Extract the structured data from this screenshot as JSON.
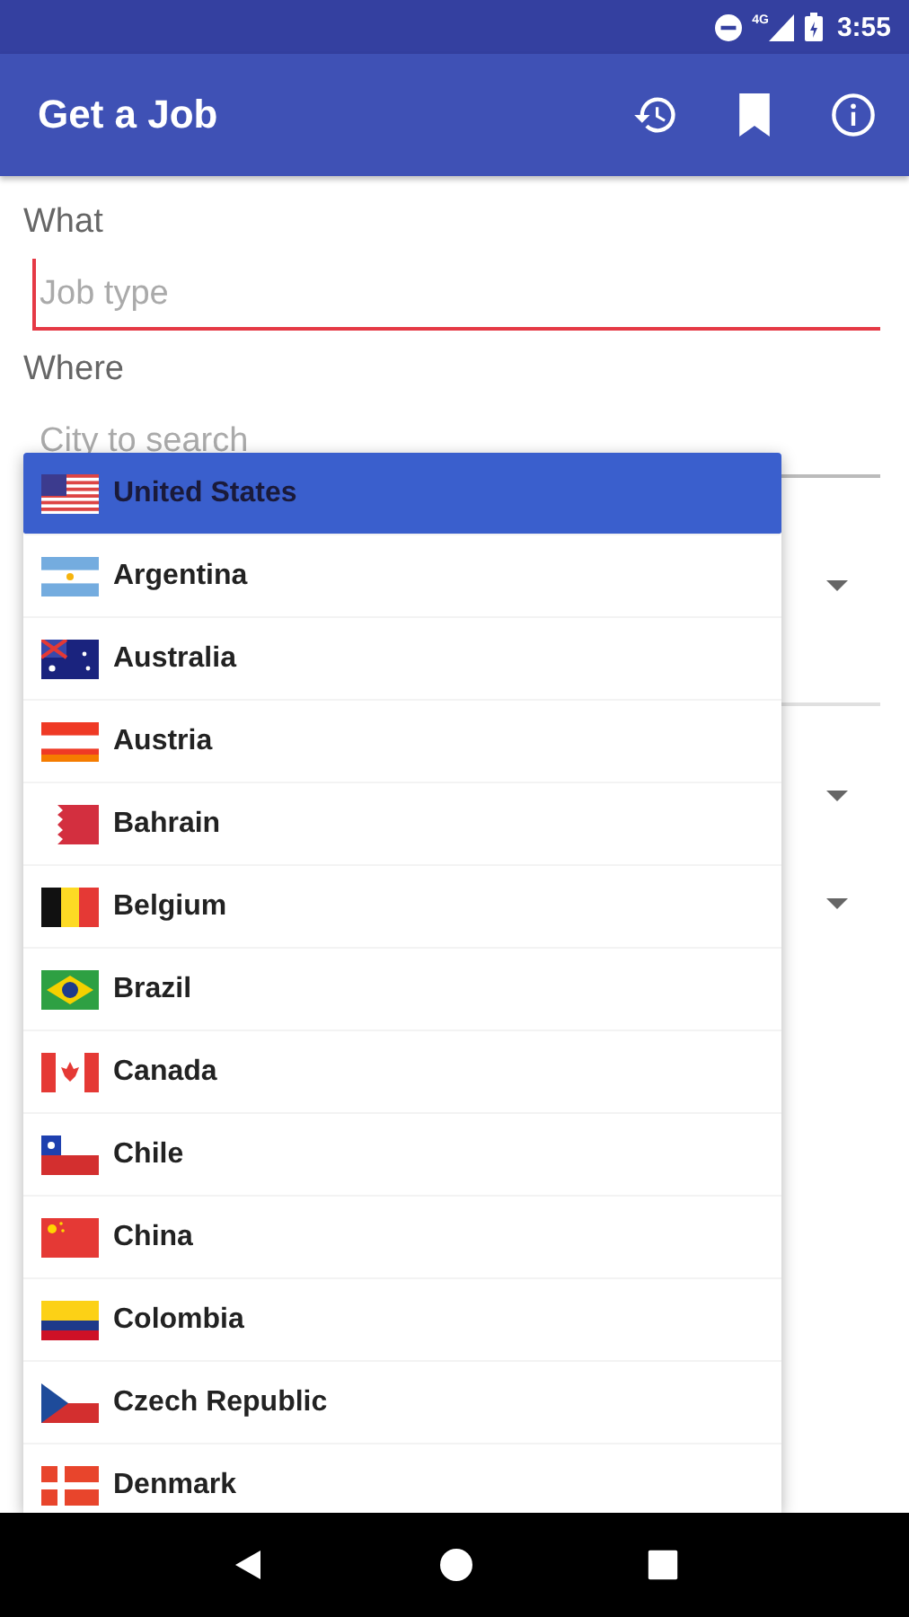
{
  "status_bar": {
    "time": "3:55",
    "network": "4G"
  },
  "app_bar": {
    "title": "Get a Job"
  },
  "form": {
    "what": {
      "label": "What",
      "placeholder": "Job type",
      "focused": true
    },
    "where": {
      "label": "Where",
      "placeholder": "City to search",
      "focused": false
    }
  },
  "country_menu": {
    "items": [
      {
        "label": "United States",
        "selected": true
      },
      {
        "label": "Argentina",
        "selected": false
      },
      {
        "label": "Australia",
        "selected": false
      },
      {
        "label": "Austria",
        "selected": false
      },
      {
        "label": "Bahrain",
        "selected": false
      },
      {
        "label": "Belgium",
        "selected": false
      },
      {
        "label": "Brazil",
        "selected": false
      },
      {
        "label": "Canada",
        "selected": false
      },
      {
        "label": "Chile",
        "selected": false
      },
      {
        "label": "China",
        "selected": false
      },
      {
        "label": "Colombia",
        "selected": false
      },
      {
        "label": "Czech Republic",
        "selected": false
      },
      {
        "label": "Denmark",
        "selected": false
      }
    ]
  }
}
